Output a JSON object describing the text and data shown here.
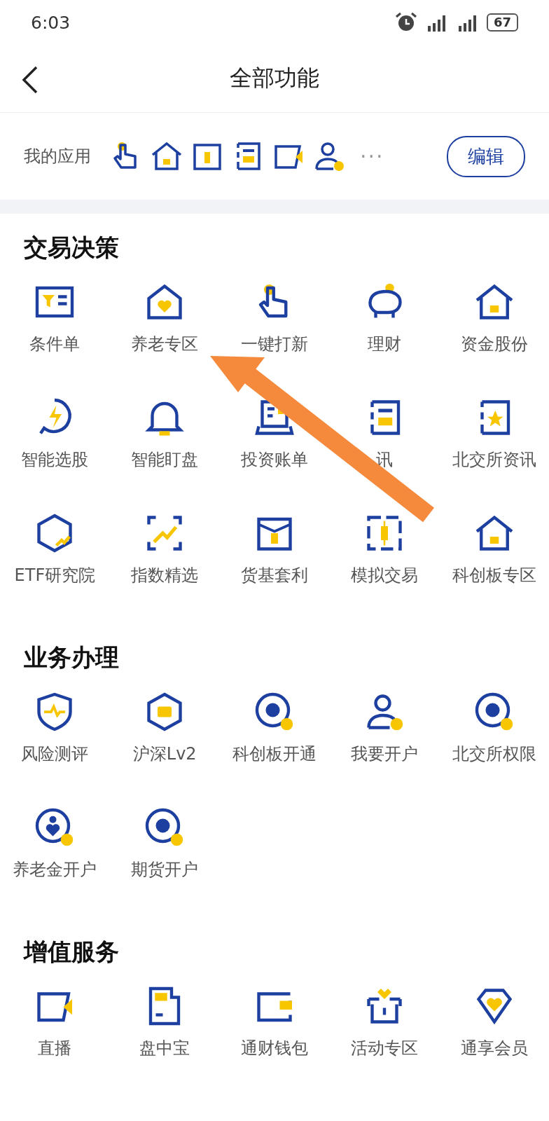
{
  "status_bar": {
    "time": "6:03",
    "battery": "67"
  },
  "header": {
    "title": "全部功能"
  },
  "my_apps": {
    "label": "我的应用",
    "more": "···",
    "edit_button": "编辑"
  },
  "sections": [
    {
      "title": "交易决策",
      "items": [
        {
          "label": "条件单"
        },
        {
          "label": "养老专区"
        },
        {
          "label": "一键打新"
        },
        {
          "label": "理财"
        },
        {
          "label": "资金股份"
        },
        {
          "label": "智能选股"
        },
        {
          "label": "智能盯盘"
        },
        {
          "label": "投资账单"
        },
        {
          "label": "讯"
        },
        {
          "label": "北交所资讯"
        },
        {
          "label": "ETF研究院"
        },
        {
          "label": "指数精选"
        },
        {
          "label": "货基套利"
        },
        {
          "label": "模拟交易"
        },
        {
          "label": "科创板专区"
        }
      ]
    },
    {
      "title": "业务办理",
      "items": [
        {
          "label": "风险测评"
        },
        {
          "label": "沪深Lv2"
        },
        {
          "label": "科创板开通"
        },
        {
          "label": "我要开户"
        },
        {
          "label": "北交所权限"
        },
        {
          "label": "养老金开户"
        },
        {
          "label": "期货开户"
        }
      ]
    },
    {
      "title": "增值服务",
      "items": [
        {
          "label": "直播"
        },
        {
          "label": "盘中宝"
        },
        {
          "label": "通财钱包"
        },
        {
          "label": "活动专区"
        },
        {
          "label": "通享会员"
        }
      ]
    }
  ]
}
